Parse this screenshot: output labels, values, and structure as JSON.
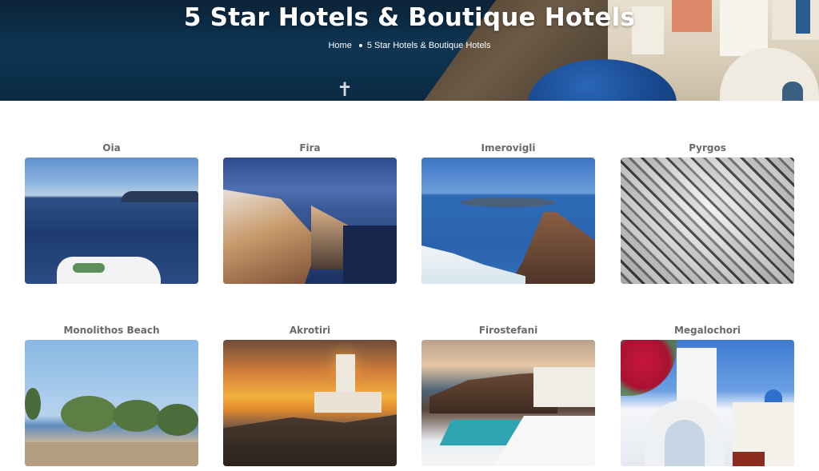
{
  "hero": {
    "title": "5 Star Hotels & Boutique Hotels"
  },
  "breadcrumb": {
    "home": "Home",
    "current": "5 Star Hotels & Boutique Hotels"
  },
  "locations": [
    {
      "name": "Oia",
      "image": "oia-sea-view-photo"
    },
    {
      "name": "Fira",
      "image": "fira-evening-cliffside-photo"
    },
    {
      "name": "Imerovigli",
      "image": "imerovigli-skaros-rock-photo"
    },
    {
      "name": "Pyrgos",
      "image": "pyrgos-aerial-black-white-photo"
    },
    {
      "name": "Monolithos Beach",
      "image": "monolithos-beach-trees-photo"
    },
    {
      "name": "Akrotiri",
      "image": "akrotiri-lighthouse-sunset-photo"
    },
    {
      "name": "Firostefani",
      "image": "firostefani-pool-sunset-photo"
    },
    {
      "name": "Megalochori",
      "image": "megalochori-bell-tower-photo"
    }
  ]
}
